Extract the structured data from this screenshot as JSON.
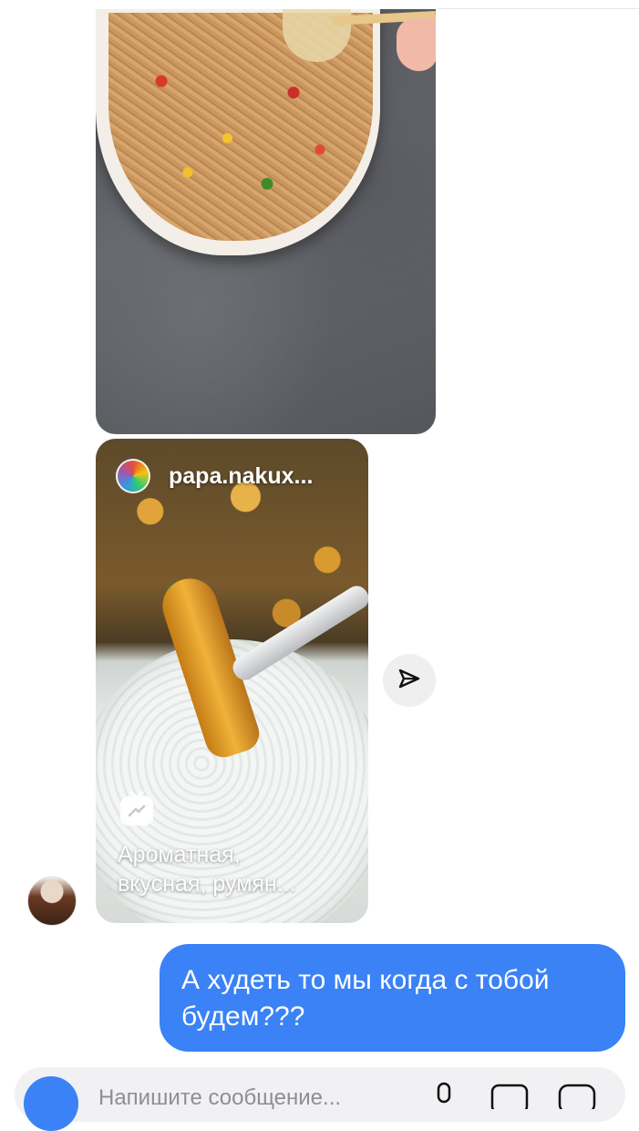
{
  "shared_reel": {
    "username": "papa.nakux...",
    "caption_line1": "Ароматная,",
    "caption_line2": "вкусная, румян..."
  },
  "outgoing_message": {
    "text": "А худеть то мы когда с тобой будем???"
  },
  "composer": {
    "placeholder": "Напишите сообщение..."
  },
  "icons": {
    "share": "paper-plane-icon",
    "reel": "reels-icon",
    "mic": "mic-icon",
    "gallery": "gallery-icon",
    "sticker": "sticker-icon",
    "camera": "camera-icon"
  },
  "colors": {
    "outgoing_bubble": "#3a82f6",
    "composer_bg": "#f1f1f3",
    "share_button_bg": "#efefef"
  }
}
